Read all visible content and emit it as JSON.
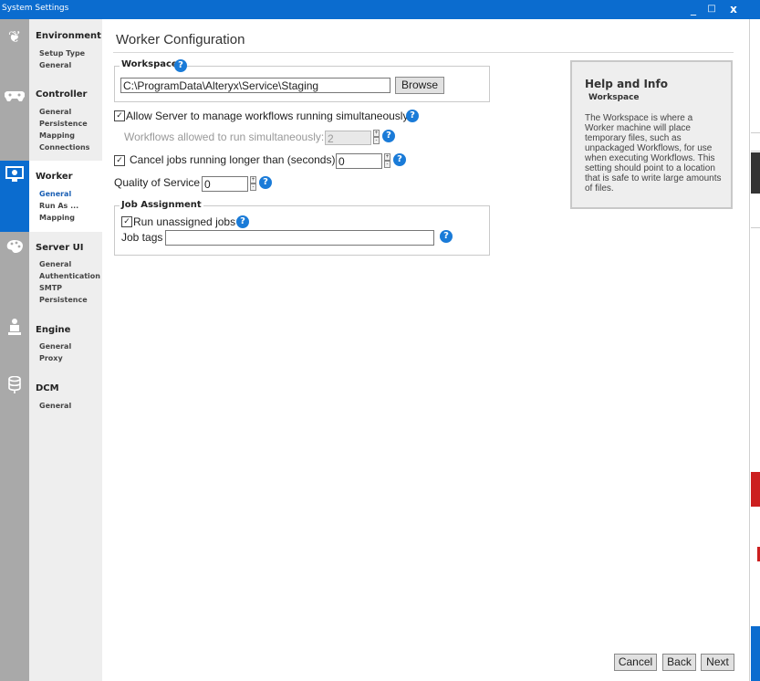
{
  "window": {
    "title": "System Settings",
    "buttons": {
      "minimize": "_",
      "maximize": "□",
      "close": "x"
    }
  },
  "sidebar": {
    "sections": [
      {
        "icon": "leaf-icon",
        "title": "Environment",
        "items": [
          "Setup Type",
          "General"
        ]
      },
      {
        "icon": "gamepad-icon",
        "title": "Controller",
        "items": [
          "General",
          "Persistence",
          "Mapping",
          "Connections"
        ]
      },
      {
        "icon": "monitor-gear-icon",
        "title": "Worker",
        "items": [
          "General",
          "Run As ...",
          "Mapping"
        ],
        "selected_item": "General"
      },
      {
        "icon": "palette-icon",
        "title": "Server UI",
        "items": [
          "General",
          "Authentication",
          "SMTP",
          "Persistence"
        ]
      },
      {
        "icon": "engine-icon",
        "title": "Engine",
        "items": [
          "General",
          "Proxy"
        ]
      },
      {
        "icon": "database-icon",
        "title": "DCM",
        "items": [
          "General"
        ]
      }
    ]
  },
  "page": {
    "title": "Worker Configuration"
  },
  "workspace": {
    "legend": "Workspace",
    "path": "C:\\ProgramData\\Alteryx\\Service\\Staging",
    "browse_label": "Browse"
  },
  "options": {
    "allow_simultaneous": {
      "label": "Allow Server to manage workflows running simultaneously",
      "checked": true
    },
    "workflows_allowed": {
      "label": "Workflows allowed to run simultaneously:",
      "value": "2",
      "disabled": true
    },
    "cancel_jobs": {
      "label": "Cancel jobs running longer than (seconds)",
      "checked": true,
      "value": "0"
    },
    "quality_of_service": {
      "label": "Quality of Service",
      "value": "0"
    }
  },
  "job_assignment": {
    "legend": "Job Assignment",
    "run_unassigned": {
      "label": "Run unassigned jobs",
      "checked": true
    },
    "job_tags": {
      "label": "Job tags",
      "value": ""
    }
  },
  "help": {
    "heading": "Help and Info",
    "subheading": "Workspace",
    "text": "The Workspace is where a Worker machine will place temporary files, such as unpackaged Workflows, for use when executing Workflows. This setting should point to a location that is safe to write large amounts of files."
  },
  "footer": {
    "cancel": "Cancel",
    "back": "Back",
    "next": "Next"
  },
  "colors": {
    "accent": "#0b6ccf",
    "sidebar_strip": "#a9a9a9",
    "nav_panel": "#eeeeee"
  }
}
